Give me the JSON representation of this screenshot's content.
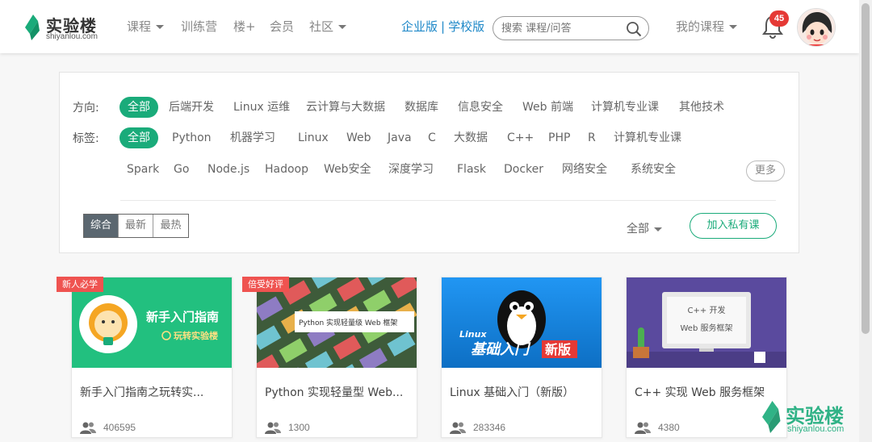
{
  "logo": {
    "name": "实验楼",
    "domain": "shiyanlou.com"
  },
  "nav": {
    "courses": "课程",
    "camp": "训练营",
    "lou_plus": "楼+",
    "member": "会员",
    "community": "社区"
  },
  "edition": {
    "enterprise": "企业版",
    "separator": "|",
    "school": "学校版"
  },
  "search": {
    "placeholder": "搜索 课程/问答"
  },
  "my_courses": "我的课程",
  "notifications": {
    "count": "45"
  },
  "filter": {
    "direction_label": "方向:",
    "directions": [
      "全部",
      "后端开发",
      "Linux 运维",
      "云计算与大数据",
      "数据库",
      "信息安全",
      "Web 前端",
      "计算机专业课",
      "其他技术"
    ],
    "tags_label": "标签:",
    "tags_row1": [
      "全部",
      "Python",
      "机器学习",
      "Linux",
      "Web",
      "Java",
      "C",
      "大数据",
      "C++",
      "PHP",
      "R",
      "计算机专业课"
    ],
    "tags_row2": [
      "Spark",
      "Go",
      "Node.js",
      "Hadoop",
      "Web安全",
      "深度学习",
      "Flask",
      "Docker",
      "网络安全",
      "系统安全"
    ],
    "more": "更多",
    "sort": [
      "综合",
      "最新",
      "最热"
    ],
    "all_select": "全部",
    "join_private": "加入私有课"
  },
  "cards": [
    {
      "tag": "新人必学",
      "title": "新手入门指南之玩转实...",
      "count": "406595",
      "thumb_line1": "新手入门指南",
      "thumb_line2": "玩转实验楼"
    },
    {
      "tag": "倍受好评",
      "title": "Python 实现轻量型 Web...",
      "count": "1300",
      "thumb_text": "Python 实现轻量级 Web 框架"
    },
    {
      "tag": "",
      "title": "Linux 基础入门（新版）",
      "count": "283346",
      "thumb_line1": "Linux",
      "thumb_line2": "基础入门",
      "thumb_badge": "新版"
    },
    {
      "tag": "",
      "title": "C++ 实现 Web 服务框架",
      "count": "4380",
      "thumb_line1": "C++ 开发",
      "thumb_line2": "Web 服务框架"
    }
  ],
  "watermark": {
    "name": "实验楼",
    "domain": "shiyanlou.com"
  }
}
